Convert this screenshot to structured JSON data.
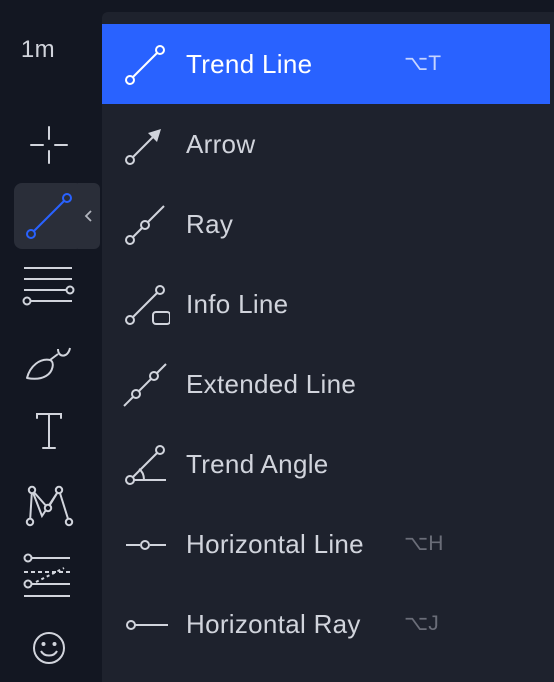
{
  "toolbar": {
    "interval": "1m",
    "tools": [
      {
        "name": "crosshair-icon",
        "active": false
      },
      {
        "name": "trend-line-icon",
        "active": true
      },
      {
        "name": "fib-retracement-icon",
        "active": false
      },
      {
        "name": "brush-icon",
        "active": false
      },
      {
        "name": "text-icon",
        "active": false
      },
      {
        "name": "pattern-icon",
        "active": false
      },
      {
        "name": "forecast-icon",
        "active": false
      },
      {
        "name": "emoji-icon",
        "active": false
      }
    ]
  },
  "menu": {
    "items": [
      {
        "label": "Trend Line",
        "shortcut": "⌥T",
        "icon": "trend-line-icon",
        "selected": true
      },
      {
        "label": "Arrow",
        "shortcut": "",
        "icon": "arrow-icon",
        "selected": false
      },
      {
        "label": "Ray",
        "shortcut": "",
        "icon": "ray-icon",
        "selected": false
      },
      {
        "label": "Info Line",
        "shortcut": "",
        "icon": "info-line-icon",
        "selected": false
      },
      {
        "label": "Extended Line",
        "shortcut": "",
        "icon": "extended-line-icon",
        "selected": false
      },
      {
        "label": "Trend Angle",
        "shortcut": "",
        "icon": "trend-angle-icon",
        "selected": false
      },
      {
        "label": "Horizontal Line",
        "shortcut": "⌥H",
        "icon": "horizontal-line-icon",
        "selected": false
      },
      {
        "label": "Horizontal Ray",
        "shortcut": "⌥J",
        "icon": "horizontal-ray-icon",
        "selected": false
      }
    ]
  },
  "colors": {
    "accent": "#2962ff",
    "background": "#131722",
    "menu_background": "#1e222d",
    "text": "#d1d4dc"
  }
}
